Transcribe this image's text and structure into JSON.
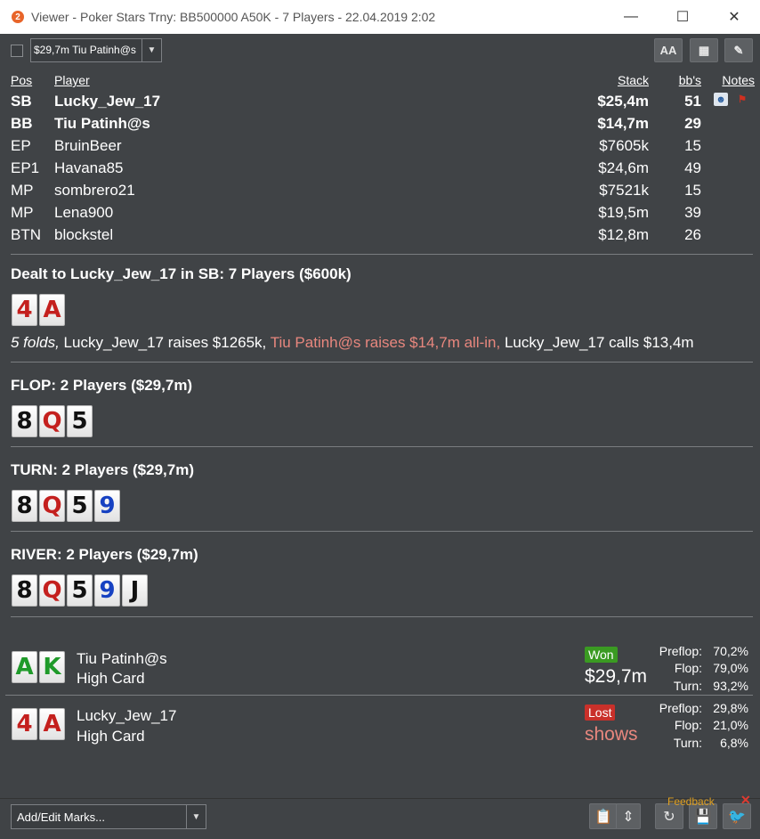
{
  "window": {
    "app_icon": "2",
    "title": "Viewer - Poker Stars Trny: BB500000 A50K - 7 Players - 22.04.2019 2:02",
    "minimize": "—",
    "maximize": "☐",
    "close": "✕"
  },
  "toolbar": {
    "hand_select_value": "$29,7m Tiu Patinh@s",
    "dropdown_arrow": "▼",
    "font_button": "AA",
    "grid_button": "▦",
    "edit_button": "✎"
  },
  "table": {
    "headers": {
      "pos": "Pos",
      "player": "Player",
      "stack": "Stack",
      "bbs": "bb's",
      "notes": "Notes"
    },
    "players": [
      {
        "pos": "SB",
        "name": "Lucky_Jew_17",
        "stack": "$25,4m",
        "bbs": "51",
        "bold": true
      },
      {
        "pos": "BB",
        "name": "Tiu Patinh@s",
        "stack": "$14,7m",
        "bbs": "29",
        "bold": true
      },
      {
        "pos": "EP",
        "name": "BruinBeer",
        "stack": "$7605k",
        "bbs": "15",
        "bold": false
      },
      {
        "pos": "EP1",
        "name": "Havana85",
        "stack": "$24,6m",
        "bbs": "49",
        "bold": false
      },
      {
        "pos": "MP",
        "name": "sombrero21",
        "stack": "$7521k",
        "bbs": "15",
        "bold": false
      },
      {
        "pos": "MP",
        "name": "Lena900",
        "stack": "$19,5m",
        "bbs": "39",
        "bold": false
      },
      {
        "pos": "BTN",
        "name": "blockstel",
        "stack": "$12,8m",
        "bbs": "26",
        "bold": false
      }
    ],
    "note_icons": [
      "person-note-icon",
      "flag-note-icon"
    ]
  },
  "preflop": {
    "title": "Dealt to Lucky_Jew_17 in SB: 7 Players ($600k)",
    "hero_cards": [
      {
        "rank": "4",
        "suit": "red"
      },
      {
        "rank": "A",
        "suit": "red"
      }
    ],
    "action_folds": "5 folds,",
    "action_raise": " Lucky_Jew_17 raises $1265k,",
    "action_allin": " Tiu Patinh@s raises $14,7m all-in,",
    "action_call": " Lucky_Jew_17 calls $13,4m"
  },
  "flop": {
    "title": "FLOP: 2 Players ($29,7m)",
    "cards": [
      {
        "rank": "8",
        "suit": "black"
      },
      {
        "rank": "Q",
        "suit": "red"
      },
      {
        "rank": "5",
        "suit": "black"
      }
    ]
  },
  "turn": {
    "title": "TURN: 2 Players ($29,7m)",
    "cards": [
      {
        "rank": "8",
        "suit": "black"
      },
      {
        "rank": "Q",
        "suit": "red"
      },
      {
        "rank": "5",
        "suit": "black"
      },
      {
        "rank": "9",
        "suit": "blue"
      }
    ]
  },
  "river": {
    "title": "RIVER: 2 Players ($29,7m)",
    "cards": [
      {
        "rank": "8",
        "suit": "black"
      },
      {
        "rank": "Q",
        "suit": "red"
      },
      {
        "rank": "5",
        "suit": "black"
      },
      {
        "rank": "9",
        "suit": "blue"
      },
      {
        "rank": "J",
        "suit": "black"
      }
    ]
  },
  "results": [
    {
      "cards": [
        {
          "rank": "A",
          "suit": "green"
        },
        {
          "rank": "K",
          "suit": "green"
        }
      ],
      "name": "Tiu Patinh@s",
      "hand": "High Card",
      "badge": "Won",
      "outcome": "$29,7m",
      "equity": [
        {
          "label": "Preflop:",
          "value": "70,2%"
        },
        {
          "label": "Flop:",
          "value": "79,0%"
        },
        {
          "label": "Turn:",
          "value": "93,2%"
        }
      ]
    },
    {
      "cards": [
        {
          "rank": "4",
          "suit": "red"
        },
        {
          "rank": "A",
          "suit": "red"
        }
      ],
      "name": "Lucky_Jew_17",
      "hand": "High Card",
      "badge": "Lost",
      "outcome": "shows",
      "equity": [
        {
          "label": "Preflop:",
          "value": "29,8%"
        },
        {
          "label": "Flop:",
          "value": "21,0%"
        },
        {
          "label": "Turn:",
          "value": "6,8%"
        }
      ]
    }
  ],
  "bottom": {
    "marks_placeholder": "Add/Edit Marks...",
    "dropdown_arrow": "▼",
    "clipboard_button": "📋",
    "updown_button": "⇕",
    "replay_button": "↻",
    "save_button": "💾",
    "twitter_button": "🐦",
    "feedback": "Feedback",
    "feedback_close": "✕"
  },
  "colors": {
    "panel_bg": "#404346",
    "red_text": "#e8877e",
    "won_badge": "#3a9a22",
    "lost_badge": "#c9302a",
    "card_red": "#c4201e",
    "card_blue": "#1742c2",
    "card_green": "#1f9a2a",
    "card_black": "#111111"
  }
}
